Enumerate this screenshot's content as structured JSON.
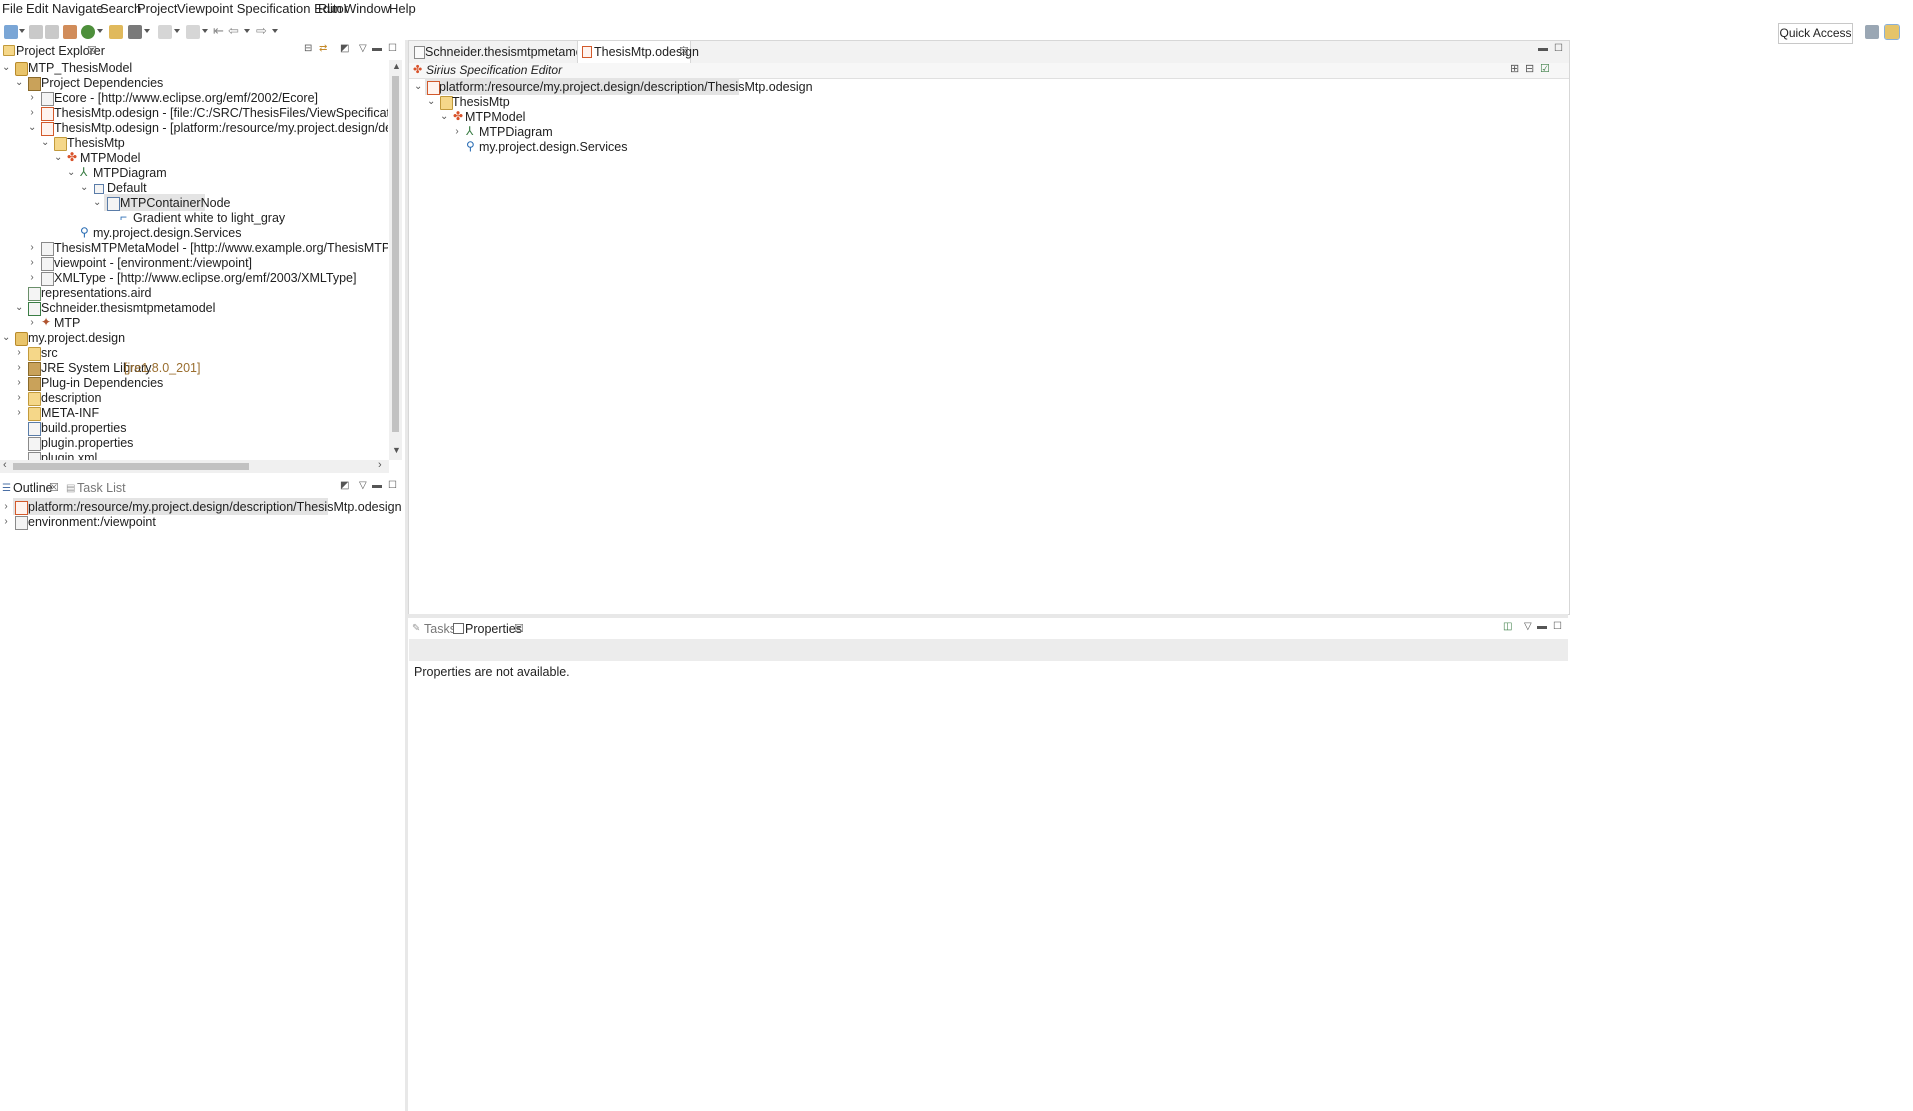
{
  "menu": [
    "File",
    "Edit",
    "Navigate",
    "Search",
    "Project",
    "Viewpoint Specification Editor",
    "Run",
    "Window",
    "Help"
  ],
  "toolbar": {
    "quick_access": "Quick Access"
  },
  "project_explorer": {
    "title": "Project Explorer",
    "tree": [
      {
        "label": "MTP_ThesisModel",
        "icon": "project-icon"
      },
      {
        "label": "Project Dependencies",
        "icon": "library-icon"
      },
      {
        "label": "Ecore - [http://www.eclipse.org/emf/2002/Ecore]",
        "icon": "file-icon"
      },
      {
        "label": "ThesisMtp.odesign - [file:/C:/SRC/ThesisFiles/ViewSpecificationFile/MTPViewS",
        "icon": "odesign-icon"
      },
      {
        "label": "ThesisMtp.odesign - [platform:/resource/my.project.design/description/Thesis",
        "icon": "odesign-icon"
      },
      {
        "label": "ThesisMtp",
        "icon": "folder-icon"
      },
      {
        "label": "MTPModel",
        "icon": "model-icon"
      },
      {
        "label": "MTPDiagram",
        "icon": "diagram-icon"
      },
      {
        "label": "Default",
        "icon": "layer-icon"
      },
      {
        "label": "MTPContainerNode",
        "icon": "container-node-icon"
      },
      {
        "label": "Gradient white to light_gray",
        "icon": "style-icon"
      },
      {
        "label": "my.project.design.Services",
        "icon": "services-icon"
      },
      {
        "label": "ThesisMTPMetaModel - [http://www.example.org/ThesisMTPMetaModel]",
        "icon": "file-icon"
      },
      {
        "label": "viewpoint - [environment:/viewpoint]",
        "icon": "file-icon"
      },
      {
        "label": "XMLType - [http://www.eclipse.org/emf/2003/XMLType]",
        "icon": "file-icon"
      },
      {
        "label": "representations.aird",
        "icon": "aird-icon"
      },
      {
        "label": "Schneider.thesismtpmetamodel",
        "icon": "model-file-icon"
      },
      {
        "label": "MTP",
        "icon": "model-icon"
      },
      {
        "label": "my.project.design",
        "icon": "project-icon"
      },
      {
        "label": "src",
        "icon": "package-folder-icon"
      },
      {
        "label": "JRE System Library",
        "icon": "library-icon",
        "decoration": "[jre1.8.0_201]"
      },
      {
        "label": "Plug-in Dependencies",
        "icon": "library-icon"
      },
      {
        "label": "description",
        "icon": "folder-icon"
      },
      {
        "label": "META-INF",
        "icon": "folder-icon"
      },
      {
        "label": "build.properties",
        "icon": "properties-icon"
      },
      {
        "label": "plugin.properties",
        "icon": "properties-icon"
      },
      {
        "label": "plugin.xml",
        "icon": "xml-icon"
      }
    ]
  },
  "outline": {
    "tabs": [
      "Outline",
      "Task List"
    ],
    "tree": [
      {
        "label": "platform:/resource/my.project.design/description/ThesisMtp.odesign"
      },
      {
        "label": "environment:/viewpoint"
      }
    ]
  },
  "editor": {
    "tabs": [
      "Schneider.thesismtpmetamodel",
      "ThesisMtp.odesign"
    ],
    "header": "Sirius Specification Editor",
    "tree": [
      {
        "label": "platform:/resource/my.project.design/description/ThesisMtp.odesign"
      },
      {
        "label": "ThesisMtp"
      },
      {
        "label": "MTPModel"
      },
      {
        "label": "MTPDiagram"
      },
      {
        "label": "my.project.design.Services"
      }
    ]
  },
  "properties": {
    "tabs": [
      "Tasks",
      "Properties"
    ],
    "message": "Properties are not available."
  }
}
